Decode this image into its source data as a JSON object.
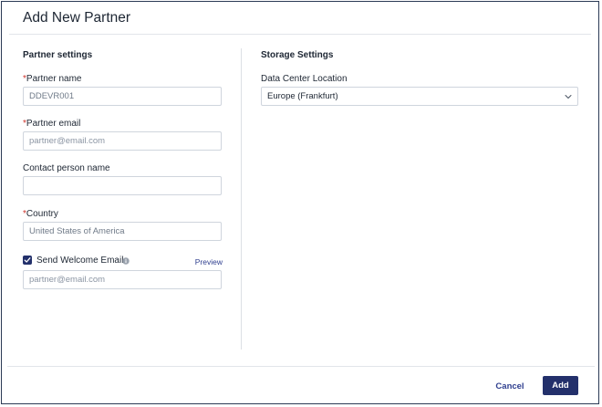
{
  "dialog": {
    "title": "Add New Partner"
  },
  "partner_settings": {
    "heading": "Partner settings",
    "required_marker": "*",
    "partner_name": {
      "label": "Partner name",
      "value": "DDEVR001"
    },
    "partner_email": {
      "label": "Partner email",
      "placeholder": "partner@email.com"
    },
    "contact_person": {
      "label": "Contact person name",
      "value": ""
    },
    "country": {
      "label": "Country",
      "value": "United States of America"
    },
    "welcome_email": {
      "label": "Send Welcome Email",
      "checked": true,
      "preview_label": "Preview",
      "placeholder": "partner@email.com"
    }
  },
  "storage_settings": {
    "heading": "Storage Settings",
    "data_center": {
      "label": "Data Center Location",
      "selected": "Europe (Frankfurt)"
    }
  },
  "footer": {
    "cancel_label": "Cancel",
    "add_label": "Add"
  },
  "icons": {
    "checkbox": "checkmark-icon",
    "info": "info-icon",
    "dropdown": "chevron-down-icon"
  },
  "colors": {
    "primary": "#23306b",
    "link": "#2f3f8f",
    "required": "#d0342c"
  }
}
